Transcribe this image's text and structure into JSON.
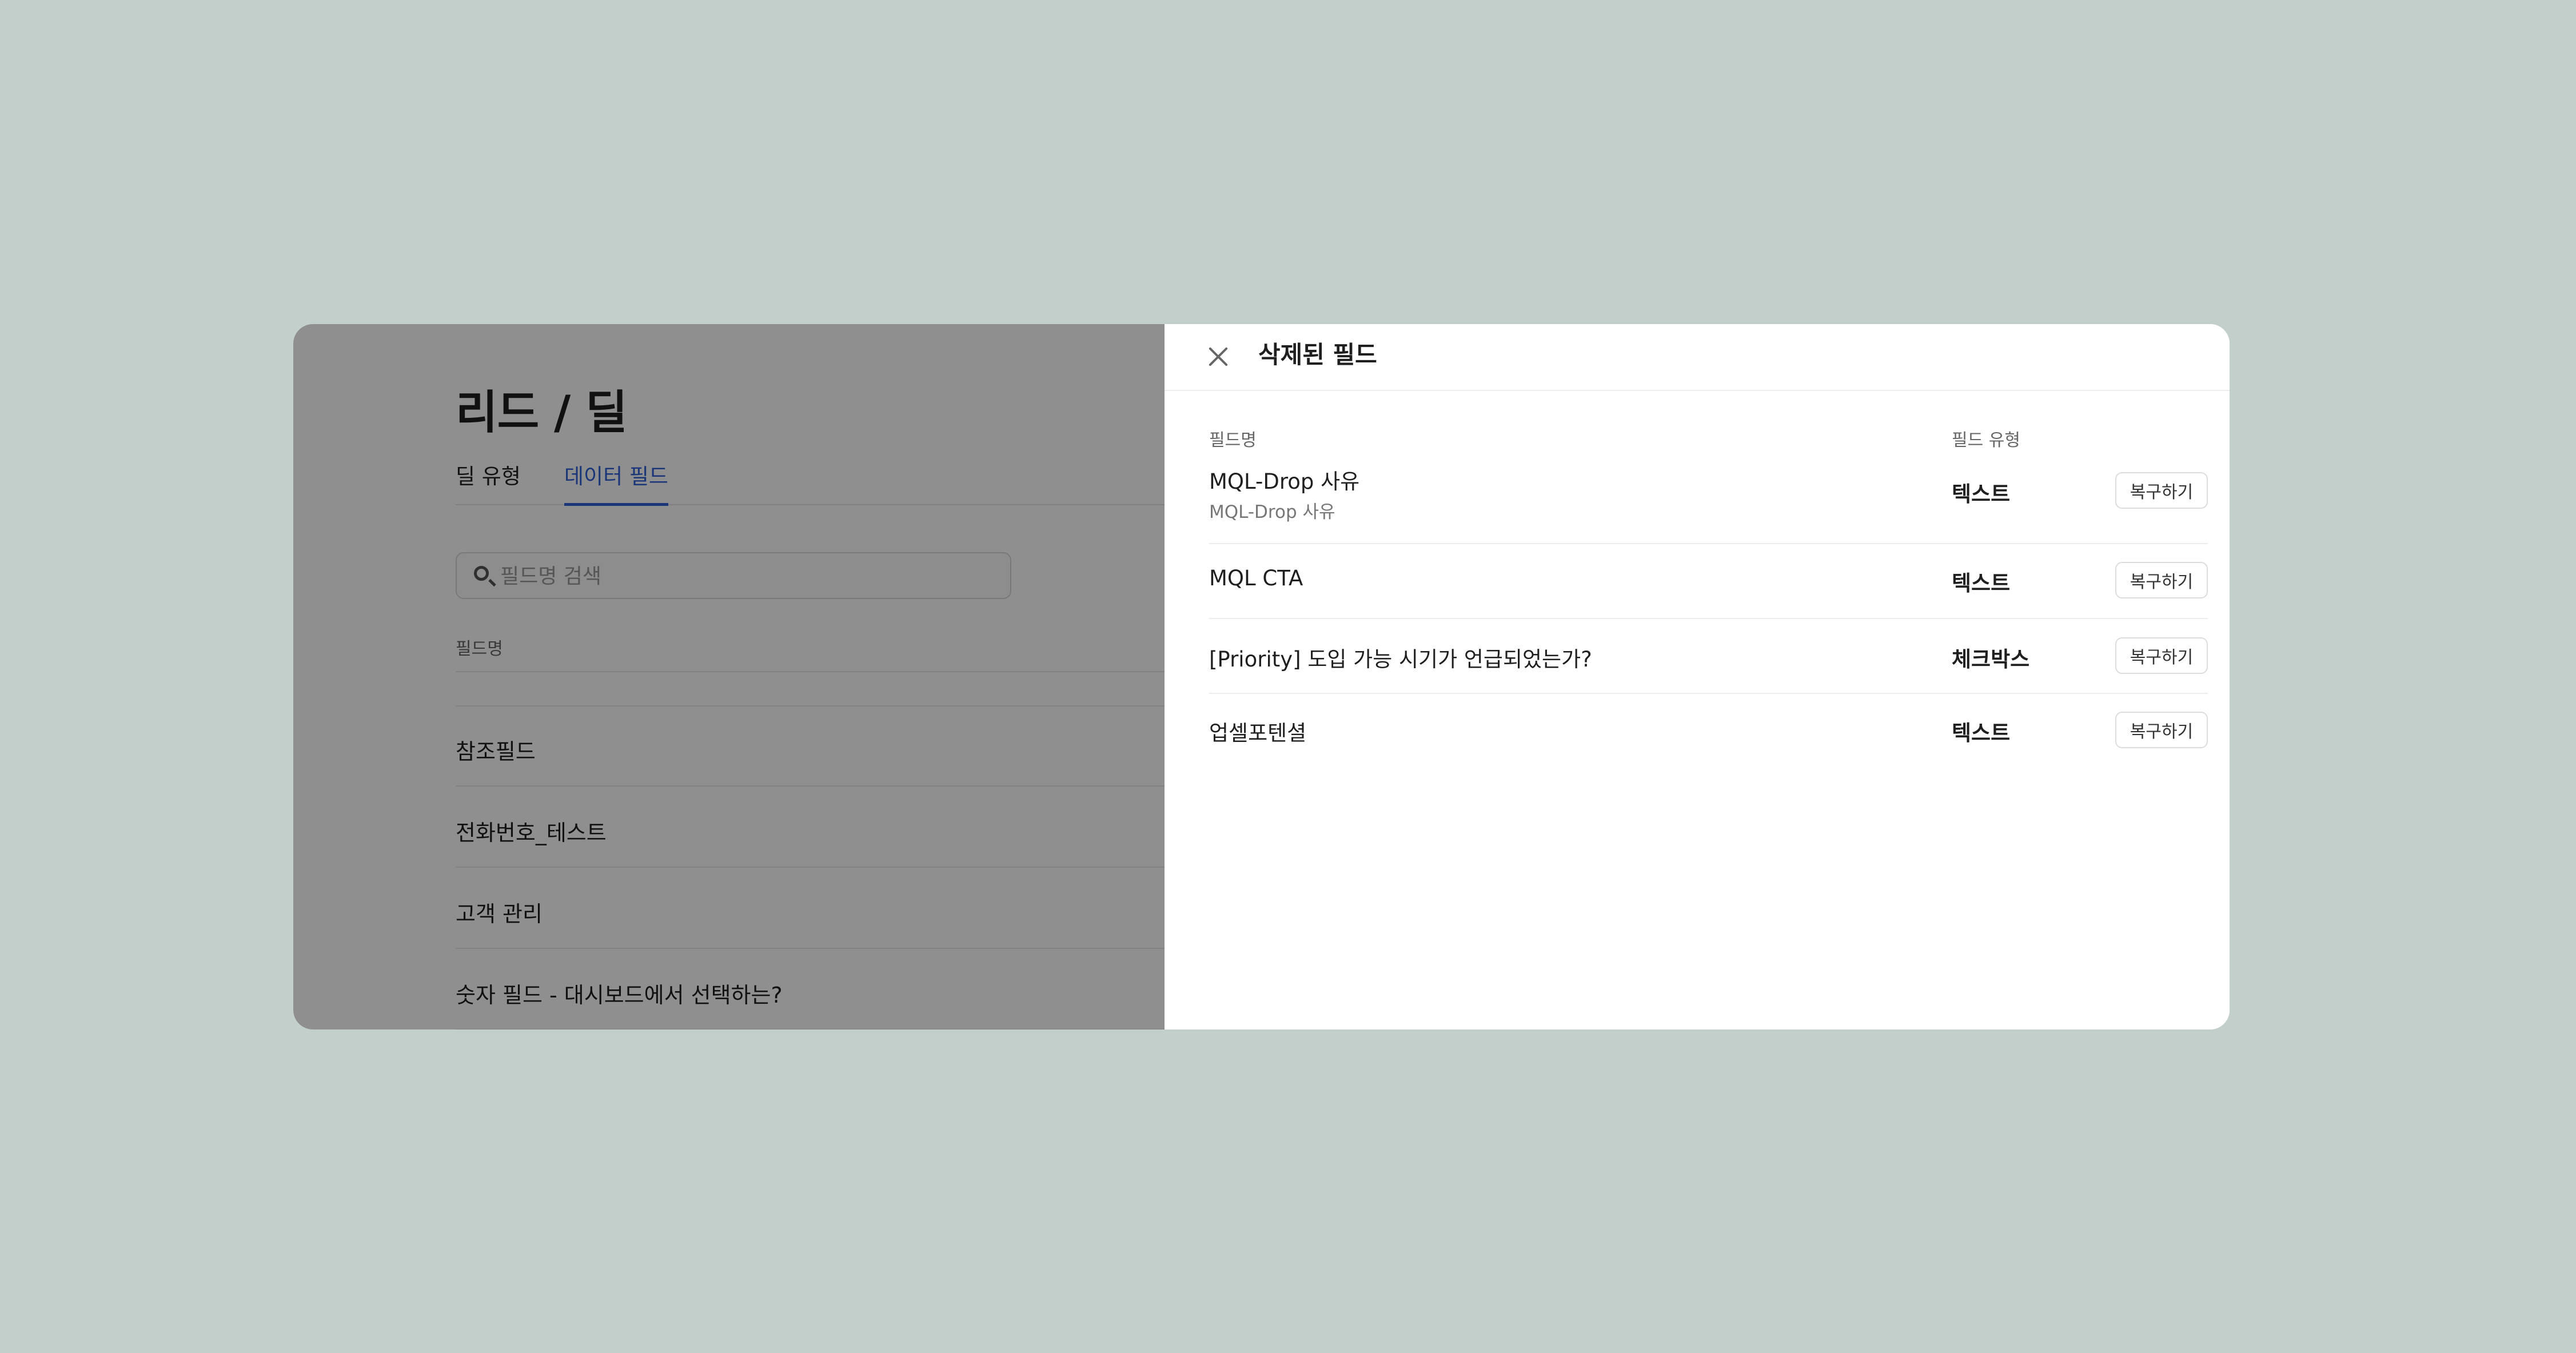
{
  "background_page": {
    "title": "리드 / 딜",
    "tabs": [
      {
        "label": "딜 유형",
        "active": false
      },
      {
        "label": "데이터 필드",
        "active": true
      }
    ],
    "search": {
      "placeholder": "필드명 검색"
    },
    "list_header": "필드명",
    "rows": [
      {
        "name": "참조필드"
      },
      {
        "name": "전화번호_테스트"
      },
      {
        "name": "고객 관리"
      },
      {
        "name": "숫자 필드 - 대시보드에서 선택하는?"
      }
    ]
  },
  "drawer": {
    "title": "삭제된 필드",
    "columns": {
      "name": "필드명",
      "type": "필드 유형"
    },
    "restore_label": "복구하기",
    "rows": [
      {
        "name": "MQL-Drop 사유",
        "subname": "MQL-Drop 사유",
        "type": "텍스트"
      },
      {
        "name": "MQL CTA",
        "subname": "",
        "type": "텍스트"
      },
      {
        "name": "[Priority] 도입 가능 시기가 언급되었는가?",
        "subname": "",
        "type": "체크박스"
      },
      {
        "name": "업셀포텐셜",
        "subname": "",
        "type": "텍스트"
      }
    ]
  },
  "colors": {
    "backdrop": "#c2cfca",
    "accent": "#2f5fd6",
    "overlay": "rgba(0,0,0,0.44)"
  }
}
